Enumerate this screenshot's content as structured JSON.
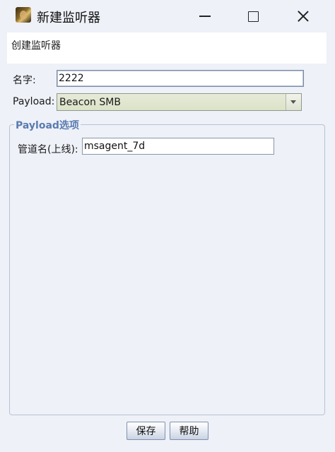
{
  "window": {
    "title": "新建监听器",
    "icon": "app-avatar-icon",
    "controls": {
      "minimize": "minimize-icon",
      "maximize": "maximize-icon",
      "close": "close-icon"
    }
  },
  "header": {
    "text": "创建监听器"
  },
  "form": {
    "name_label": "名字:",
    "name_value": "2222",
    "payload_label": "Payload:",
    "payload_value": "Beacon SMB"
  },
  "payload_options": {
    "legend": "Payload选项",
    "pipe_label": "管道名(上线):",
    "pipe_value": "msagent_7d"
  },
  "buttons": {
    "save": "保存",
    "help": "帮助"
  }
}
